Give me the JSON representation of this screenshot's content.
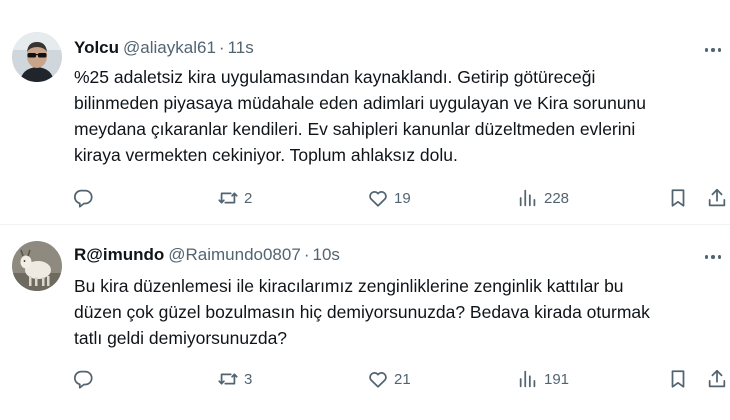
{
  "tweets": [
    {
      "display_name": "Yolcu",
      "handle": "@aliaykal61",
      "separator": "·",
      "time": "11s",
      "text": "%25 adaletsiz kira uygulamasından kaynaklandı. Getirip götüreceği\nbilinmeden piyasaya müdahale eden adimlari uygulayan ve Kira sorununu\nmeydana çıkaranlar kendileri. Ev sahipleri kanunlar düzeltmeden evlerini\nkiraya vermekten cekiniyor. Toplum ahlaksız dolu.",
      "retweets": "2",
      "likes": "19",
      "views": "228",
      "avatar": "man-with-sunglasses"
    },
    {
      "display_name": "R@imundo",
      "handle": "@Raimundo0807",
      "separator": "·",
      "time": "10s",
      "text": "Bu kira düzenlemesi ile kiracılarımız zenginliklerine zenginlik kattılar bu\ndüzen çok güzel bozulmasın hiç demiyorsunuzda? Bedava kirada oturmak\ntatlı geldi demiyorsunuzda?",
      "retweets": "3",
      "likes": "21",
      "views": "191",
      "avatar": "goat"
    }
  ],
  "icons": {
    "reply": "reply-icon",
    "retweet": "retweet-icon",
    "like": "heart-icon",
    "views": "views-icon",
    "bookmark": "bookmark-icon",
    "share": "share-icon",
    "more": "more-icon"
  },
  "colors": {
    "text": "#0f1419",
    "secondary": "#536471",
    "divider": "#eff3f4"
  }
}
